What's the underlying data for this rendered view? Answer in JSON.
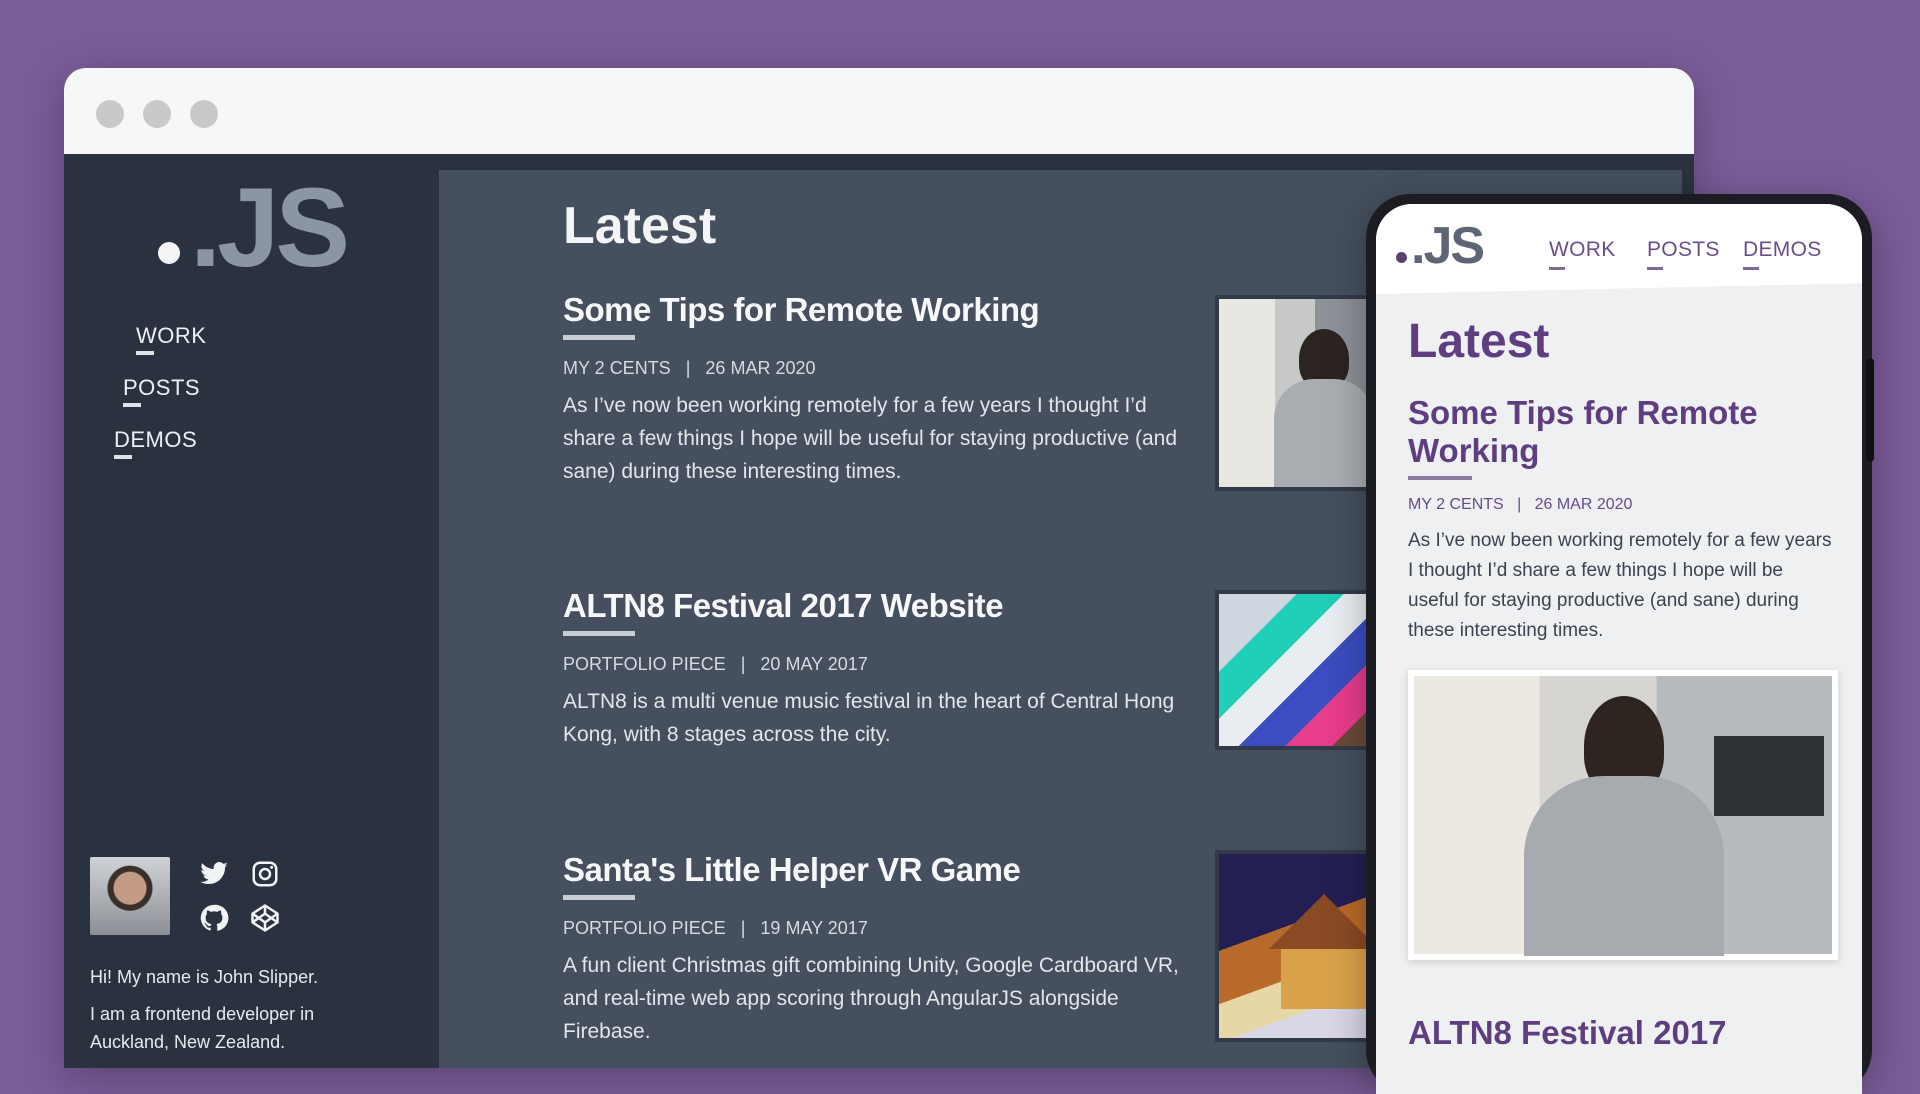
{
  "colors": {
    "background": "#7a5c98",
    "sidebar": "#2a3240",
    "main": "#454f5d",
    "mobile_accent": "#5e3e80"
  },
  "desktop": {
    "logo": ".JS",
    "nav": [
      "WORK",
      "POSTS",
      "DEMOS"
    ],
    "bio": [
      "Hi! My name is John Slipper.",
      "I am a frontend developer in Auckland, New Zealand."
    ],
    "social_icons": [
      "twitter-icon",
      "instagram-icon",
      "github-icon",
      "codepen-icon"
    ],
    "heading": "Latest",
    "posts": [
      {
        "title": "Some Tips for Remote Working",
        "category": "MY 2 CENTS",
        "date": "26 MAR 2020",
        "excerpt": "As I’ve now been working remotely for a few years I thought I’d share a few things I hope will be useful for staying productive (and sane) during these interesting times."
      },
      {
        "title": "ALTN8 Festival 2017 Website",
        "category": "PORTFOLIO PIECE",
        "date": "20 MAY 2017",
        "excerpt": "ALTN8 is a multi venue music festival in the heart of Central Hong Kong, with 8 stages across the city."
      },
      {
        "title": "Santa's Little Helper VR Game",
        "category": "PORTFOLIO PIECE",
        "date": "19 MAY 2017",
        "excerpt": "A fun client Christmas gift combining Unity, Google Cardboard VR, and real-time web app scoring through AngularJS alongside Firebase."
      }
    ],
    "separator": "|"
  },
  "mobile": {
    "logo": ".JS",
    "nav": [
      "WORK",
      "POSTS",
      "DEMOS"
    ],
    "heading": "Latest",
    "post": {
      "title": "Some Tips for Remote Working",
      "category": "MY 2 CENTS",
      "date": "26 MAR 2020",
      "excerpt": "As I’ve now been working remotely for a few years I thought I’d share a few things I hope will be useful for staying productive (and sane) during these interesting times."
    },
    "next_title": "ALTN8 Festival 2017"
  }
}
